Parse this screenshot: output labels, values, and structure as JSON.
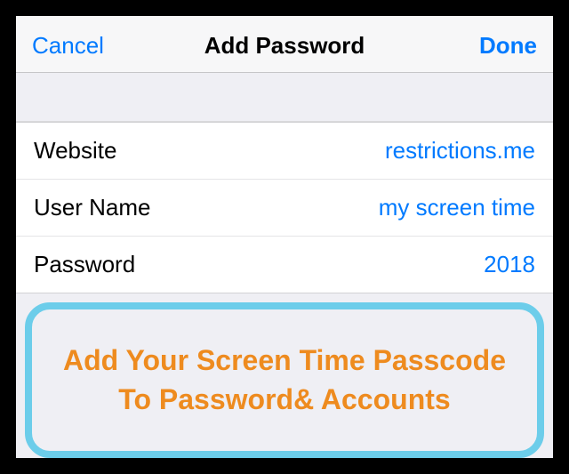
{
  "nav": {
    "cancel": "Cancel",
    "title": "Add Password",
    "done": "Done"
  },
  "fields": {
    "website": {
      "label": "Website",
      "value": "restrictions.me"
    },
    "username": {
      "label": "User Name",
      "value": "my screen time"
    },
    "password": {
      "label": "Password",
      "value": "2018"
    }
  },
  "callout": "Add Your Screen Time Passcode To Password& Accounts",
  "colors": {
    "accent": "#007aff",
    "calloutBorder": "#6ccdea",
    "calloutText": "#ee8b1f"
  }
}
